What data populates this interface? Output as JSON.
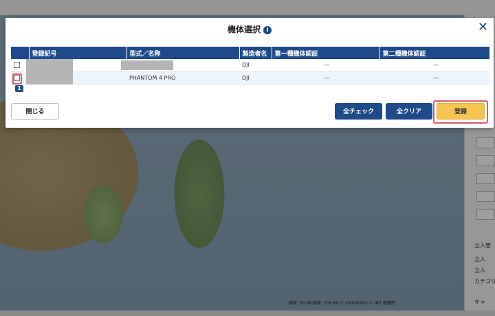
{
  "modal": {
    "title": "機体選択",
    "close_glyph": "✕",
    "info_glyph": "i"
  },
  "table": {
    "columns": [
      "",
      "登録記号",
      "型式／名称",
      "製造者名",
      "第一種機体認証",
      "第二種機体認証"
    ],
    "rows": [
      {
        "reg": "",
        "model": "",
        "maker": "DJI",
        "cert1": "—",
        "cert2": "—"
      },
      {
        "reg": "",
        "model": "PHANTOM 4 PRO",
        "maker": "DJI",
        "cert1": "—",
        "cert2": "—"
      }
    ]
  },
  "annotation": {
    "badge": "1"
  },
  "buttons": {
    "close": "閉じる",
    "check_all": "全チェック",
    "clear_all": "全クリア",
    "register": "登録"
  },
  "background": {
    "side_labels": [
      "立入管",
      "立入",
      "立入",
      "カテゴリ",
      "キャ"
    ],
    "map_scale": "緯度: 35.69 経度: 139.69 (1:20000000) © 国土地理院"
  },
  "colors": {
    "header_blue": "#1e4a8a",
    "register_yellow": "#f5c451",
    "highlight_red": "#e05a6a"
  }
}
